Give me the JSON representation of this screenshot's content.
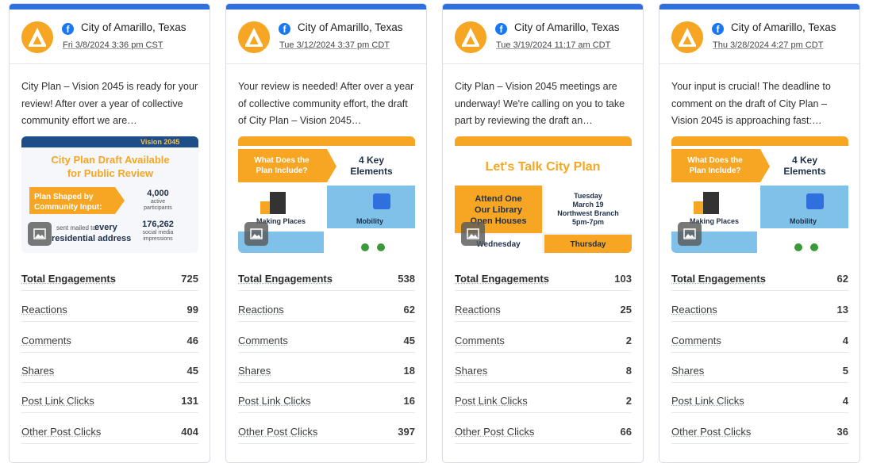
{
  "colors": {
    "accent": "#2f6fde",
    "facebook": "#1877f2",
    "brand_orange": "#f6a623",
    "brand_blue": "#7fc1e8"
  },
  "cards": [
    {
      "page_name": "City of Amarillo, Texas",
      "date": "Fri 3/8/2024 3:36 pm CST",
      "message": "City Plan – Vision 2045 is ready for your review! After over a year of collective community effort we are…",
      "image_texts": [
        "Vision 2045",
        "City Plan Draft Available",
        "for Public Review",
        "Plan Shaped by",
        "Community Input:",
        "4,000",
        "active",
        "participants",
        "176,262",
        "social media",
        "impressions",
        "every",
        "residential address",
        "sent mailed to"
      ],
      "metrics": [
        {
          "label": "Total Engagements",
          "value": "725"
        },
        {
          "label": "Reactions",
          "value": "99"
        },
        {
          "label": "Comments",
          "value": "46"
        },
        {
          "label": "Shares",
          "value": "45"
        },
        {
          "label": "Post Link Clicks",
          "value": "131"
        },
        {
          "label": "Other Post Clicks",
          "value": "404"
        }
      ]
    },
    {
      "page_name": "City of Amarillo, Texas",
      "date": "Tue 3/12/2024 3:37 pm CDT",
      "message": "Your review is needed! After over a year of collective community effort, the draft of City Plan – Vision 2045…",
      "image_texts": [
        "What Does the",
        "Plan Include?",
        "4 Key",
        "Elements",
        "Making Places",
        "Mobility"
      ],
      "metrics": [
        {
          "label": "Total Engagements",
          "value": "538"
        },
        {
          "label": "Reactions",
          "value": "62"
        },
        {
          "label": "Comments",
          "value": "45"
        },
        {
          "label": "Shares",
          "value": "18"
        },
        {
          "label": "Post Link Clicks",
          "value": "16"
        },
        {
          "label": "Other Post Clicks",
          "value": "397"
        }
      ]
    },
    {
      "page_name": "City of Amarillo, Texas",
      "date": "Tue 3/19/2024 11:17 am CDT",
      "message": "City Plan – Vision 2045 meetings are underway! We're calling on you to take part by reviewing the draft an…",
      "image_texts": [
        "Let's Talk City Plan",
        "Attend One",
        "Our Library",
        "Open Houses",
        "Tuesday",
        "March 19",
        "Northwest Branch",
        "5pm-7pm",
        "Wednesday",
        "Thursday"
      ],
      "metrics": [
        {
          "label": "Total Engagements",
          "value": "103"
        },
        {
          "label": "Reactions",
          "value": "25"
        },
        {
          "label": "Comments",
          "value": "2"
        },
        {
          "label": "Shares",
          "value": "8"
        },
        {
          "label": "Post Link Clicks",
          "value": "2"
        },
        {
          "label": "Other Post Clicks",
          "value": "66"
        }
      ]
    },
    {
      "page_name": "City of Amarillo, Texas",
      "date": "Thu 3/28/2024 4:27 pm CDT",
      "message": "Your input is crucial! The deadline to comment on the draft of City Plan – Vision 2045 is approaching fast:…",
      "image_texts": [
        "What Does the",
        "Plan Include?",
        "4 Key",
        "Elements",
        "Making Places",
        "Mobility"
      ],
      "metrics": [
        {
          "label": "Total Engagements",
          "value": "62"
        },
        {
          "label": "Reactions",
          "value": "13"
        },
        {
          "label": "Comments",
          "value": "4"
        },
        {
          "label": "Shares",
          "value": "5"
        },
        {
          "label": "Post Link Clicks",
          "value": "4"
        },
        {
          "label": "Other Post Clicks",
          "value": "36"
        }
      ]
    }
  ]
}
